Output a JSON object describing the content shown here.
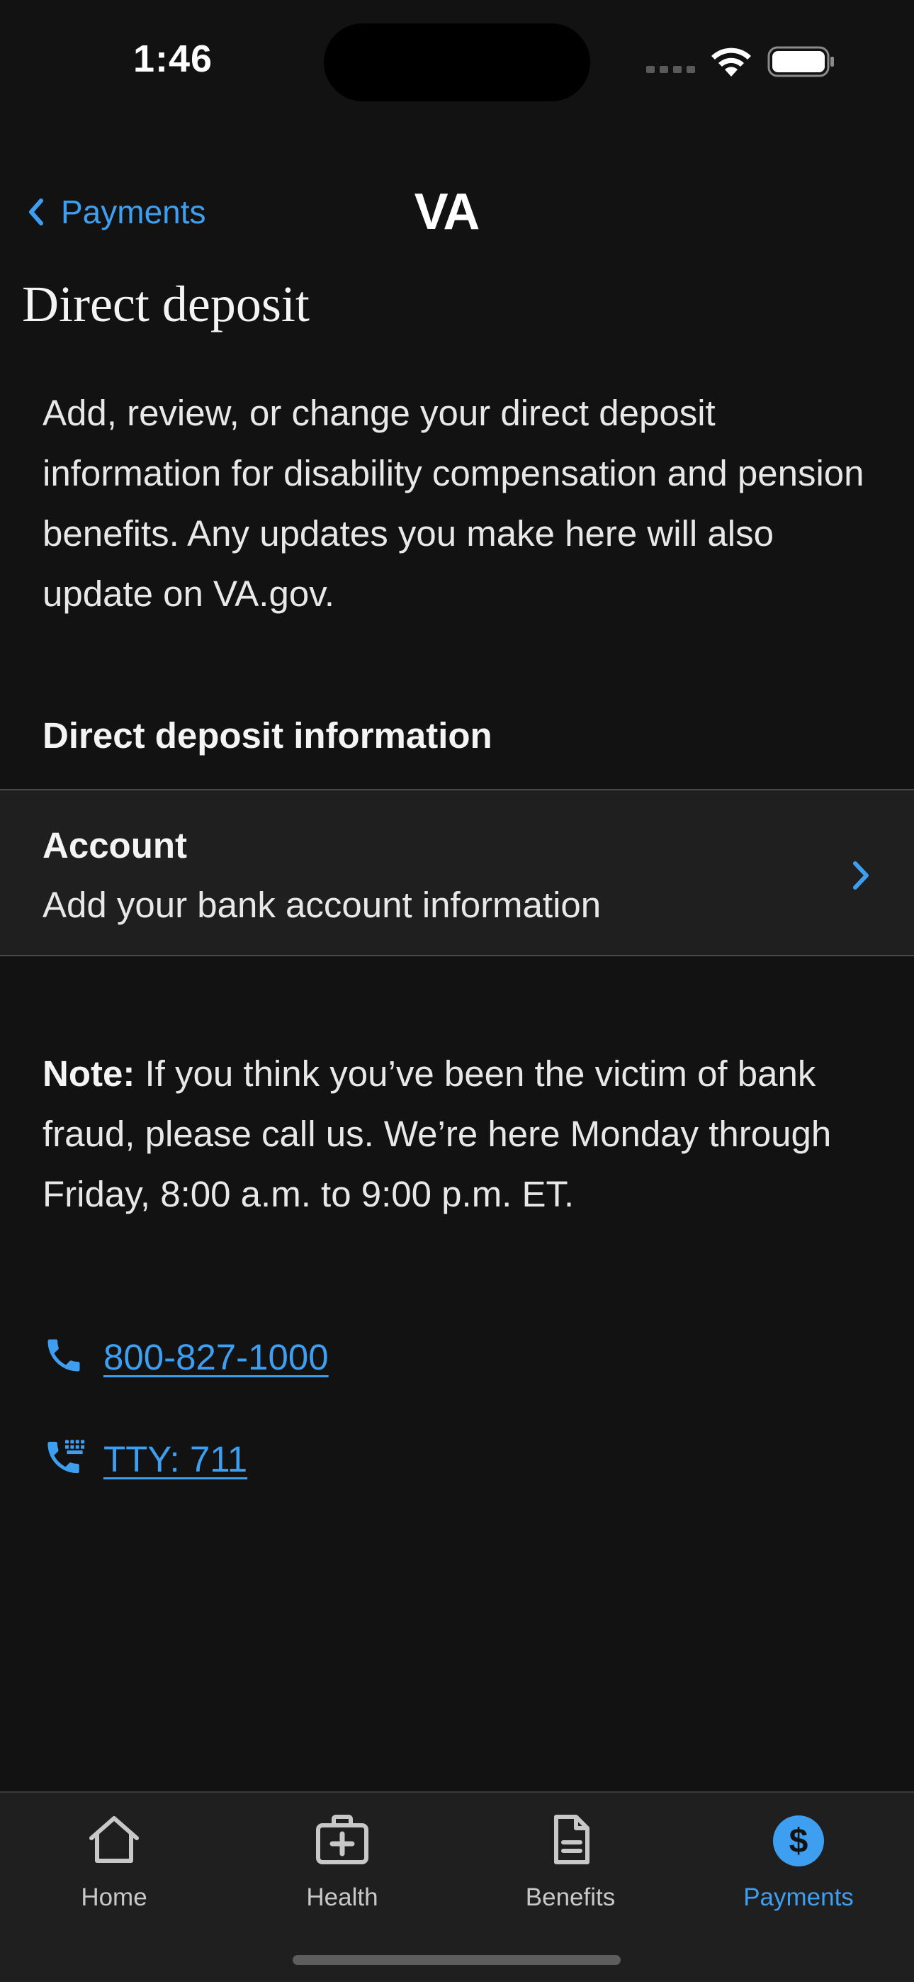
{
  "status_bar": {
    "time": "1:46"
  },
  "nav": {
    "back_label": "Payments",
    "logo": "VA"
  },
  "page": {
    "title": "Direct deposit",
    "intro": "Add, review, or change your direct deposit information for disability compensation and pension benefits. Any updates you make here will also update on VA.gov.",
    "section_heading": "Direct deposit information",
    "account": {
      "label": "Account",
      "sub": "Add your bank account information"
    },
    "note": {
      "prefix": "Note:",
      "text": " If you think you’ve been the victim of bank fraud, please call us. We’re here Monday through Friday, 8:00 a.m. to 9:00 p.m. ET."
    },
    "contacts": {
      "phone": "800-827-1000",
      "tty": "TTY: 711"
    }
  },
  "tab_bar": {
    "tabs": [
      {
        "label": "Home",
        "icon": "home-icon",
        "active": false
      },
      {
        "label": "Health",
        "icon": "medical-kit-icon",
        "active": false
      },
      {
        "label": "Benefits",
        "icon": "document-icon",
        "active": false
      },
      {
        "label": "Payments",
        "icon": "dollar-icon",
        "active": true
      }
    ]
  },
  "colors": {
    "background": "#121212",
    "surface": "#1f1f1f",
    "accent": "#3e9ff1",
    "text": "#f1f1f1"
  }
}
